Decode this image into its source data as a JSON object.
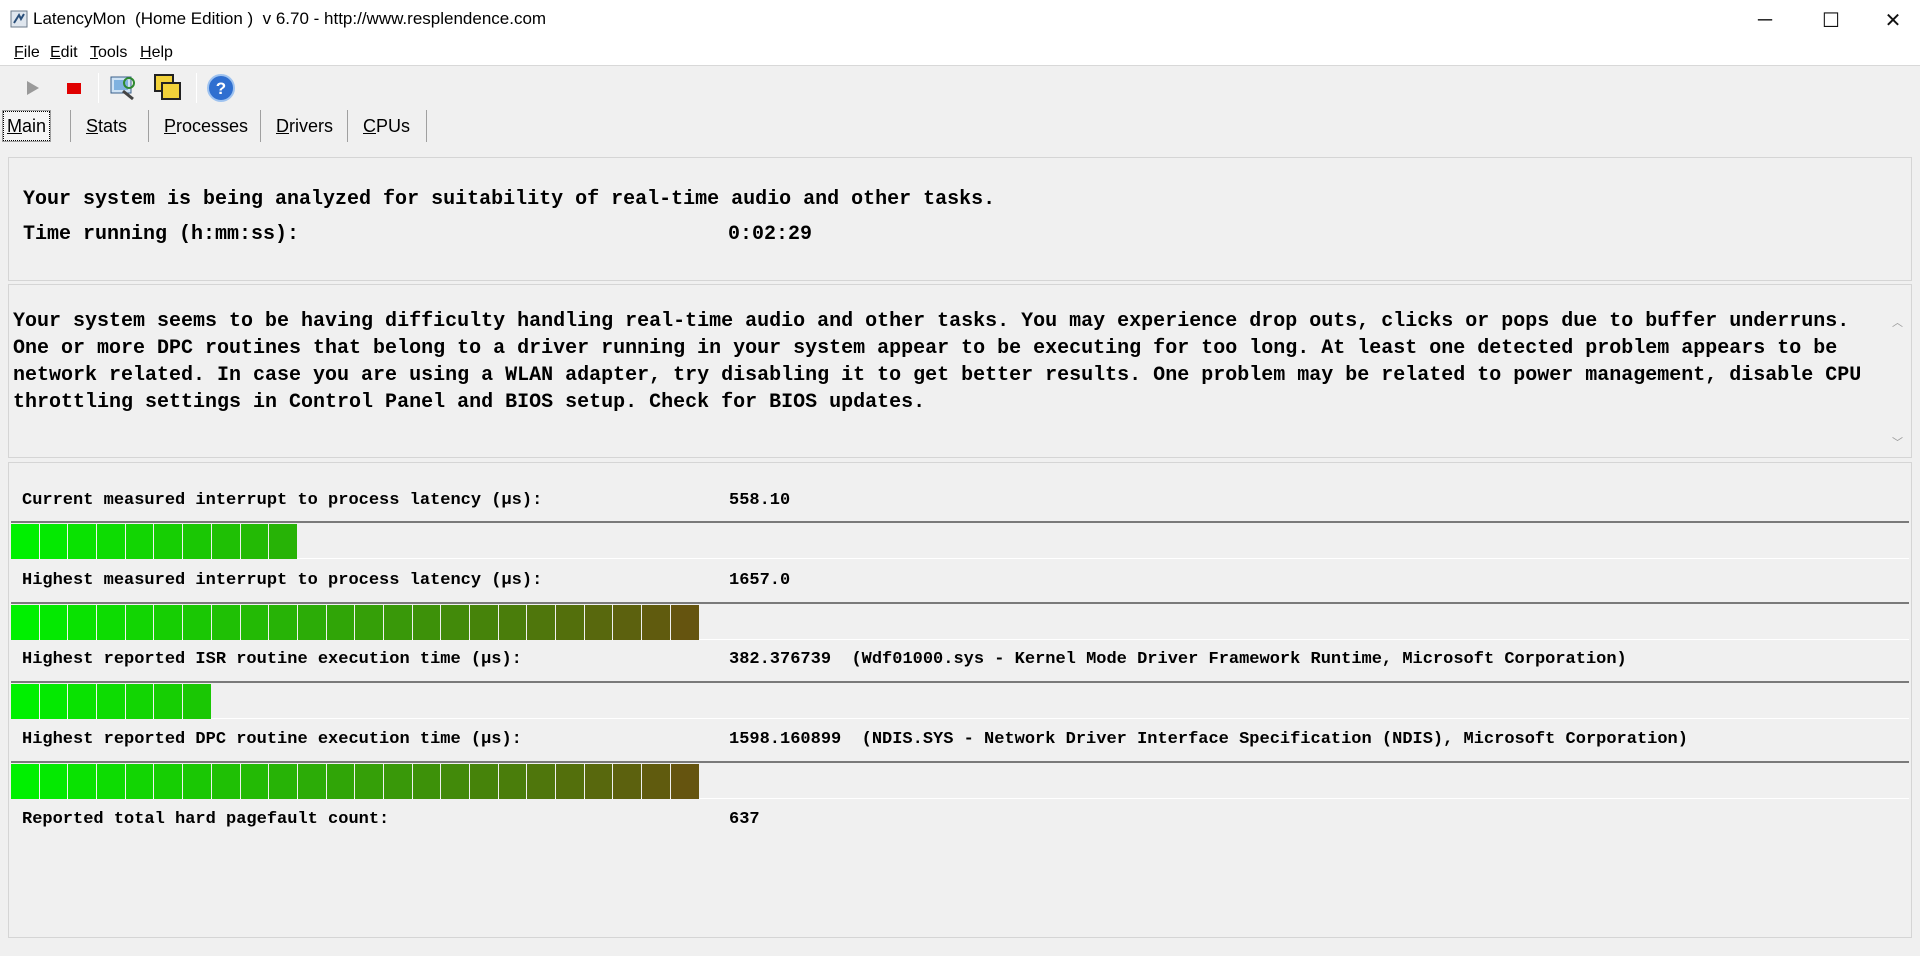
{
  "window": {
    "title": "LatencyMon  (Home Edition )  v 6.70 - http://www.resplendence.com",
    "minimize_glyph": "─",
    "maximize_glyph": "☐",
    "close_glyph": "✕"
  },
  "menu": [
    {
      "underline": "F",
      "rest": "ile"
    },
    {
      "underline": "E",
      "rest": "dit"
    },
    {
      "underline": "T",
      "rest": "ools"
    },
    {
      "underline": "H",
      "rest": "elp"
    }
  ],
  "toolbar": {
    "icons": [
      "play-icon",
      "stop-icon",
      "analyze-icon",
      "windows-icon",
      "help-icon"
    ],
    "help_glyph": "?"
  },
  "tabs": [
    {
      "underline": "M",
      "rest": "ain"
    },
    {
      "underline": "S",
      "rest": "tats"
    },
    {
      "underline": "P",
      "rest": "rocesses"
    },
    {
      "underline": "D",
      "rest": "rivers"
    },
    {
      "underline": "C",
      "rest": "PUs"
    }
  ],
  "status": {
    "line1": "Your system is being analyzed for suitability of real-time audio and other tasks.",
    "time_label": "Time running (h:mm:ss):",
    "time_value": "0:02:29"
  },
  "message": "Your system seems to be having difficulty handling real-time audio and other tasks. You may experience drop outs, clicks or pops due to buffer underruns. One or more DPC routines that belong to a driver running in your system appear to be executing for too long. At least one detected problem appears to be network related. In case you are using a WLAN adapter, try disabling it to get better results. One problem may be related to power management, disable CPU throttling settings in Control Panel and BIOS setup. Check for BIOS updates.",
  "metrics": [
    {
      "label": "Current measured interrupt to process latency (µs):",
      "value": "558.10",
      "detail": "",
      "level": 0.155
    },
    {
      "label": "Highest measured interrupt to process latency (µs):",
      "value": "1657.0",
      "detail": "",
      "level": 0.367
    },
    {
      "label": "Highest reported ISR routine execution time (µs):",
      "value": "382.376739",
      "detail": "(Wdf01000.sys - Kernel Mode Driver Framework Runtime, Microsoft Corporation)",
      "level": 0.103
    },
    {
      "label": "Highest reported DPC routine execution time (µs):",
      "value": "1598.160899",
      "detail": "(NDIS.SYS - Network Driver Interface Specification (NDIS), Microsoft Corporation)",
      "level": 0.369
    },
    {
      "label": "Reported total hard pagefault count:",
      "value": "637",
      "detail": "",
      "level": null
    }
  ],
  "bar_colors": {
    "start": "#00f000",
    "end": "#6b4a10"
  }
}
